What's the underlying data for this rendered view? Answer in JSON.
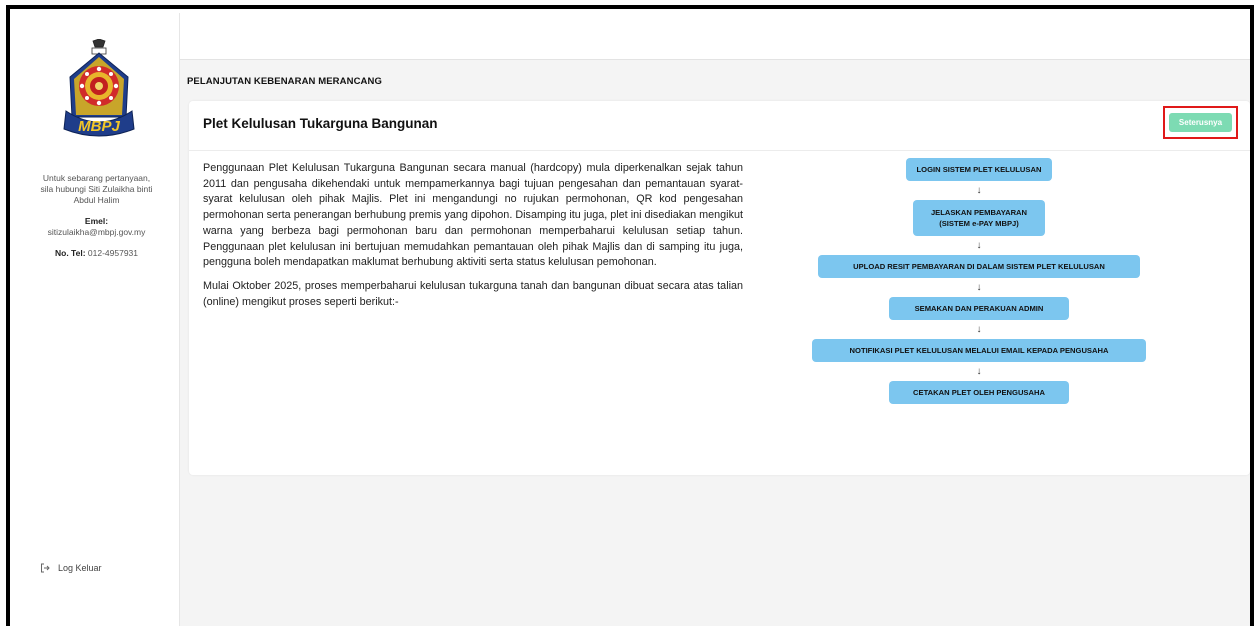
{
  "sidebar": {
    "contact_lines": [
      "Untuk sebarang pertanyaan,",
      "sila hubungi Siti Zulaikha binti",
      "Abdul Halim"
    ],
    "email_label": "Emel:",
    "email_value": "sitizulaikha@mbpj.gov.my",
    "phone_label": "No. Tel:",
    "phone_value": "012-4957931",
    "logout_label": "Log Keluar",
    "logo_text": "MBPJ"
  },
  "page": {
    "title": "PELANJUTAN KEBENARAN MERANCANG"
  },
  "card": {
    "title": "Plet Kelulusan Tukarguna Bangunan",
    "next_label": "Seterusnya",
    "paragraphs": [
      "Penggunaan Plet Kelulusan Tukarguna Bangunan secara manual (hardcopy) mula diperkenalkan sejak tahun 2011 dan pengusaha dikehendaki untuk mempamerkannya bagi tujuan pengesahan dan pemantauan syarat-syarat kelulusan oleh pihak Majlis. Plet ini mengandungi no rujukan permohonan, QR kod pengesahan permohonan serta penerangan berhubung premis yang dipohon. Disamping itu juga, plet ini disediakan mengikut warna yang berbeza bagi permohonan baru dan permohonan memperbaharui kelulusan setiap tahun. Penggunaan plet kelulusan ini bertujuan memudahkan pemantauan oleh pihak Majlis dan di samping itu juga, pengguna boleh mendapatkan maklumat berhubung aktiviti serta status kelulusan pemohonan.",
      "Mulai Oktober 2025, proses memperbaharui kelulusan tukarguna tanah dan bangunan dibuat secara atas talian (online) mengikut proses seperti berikut:-"
    ]
  },
  "flow": {
    "arrow": "↓",
    "steps": [
      [
        "LOGIN SISTEM PLET KELULUSAN"
      ],
      [
        "JELASKAN PEMBAYARAN",
        "(SISTEM e-PAY MBPJ)"
      ],
      [
        "UPLOAD RESIT PEMBAYARAN DI DALAM SISTEM PLET KELULUSAN"
      ],
      [
        "SEMAKAN DAN PERAKUAN ADMIN"
      ],
      [
        "NOTIFIKASI PLET KELULUSAN MELALUI EMAIL KEPADA PENGUSAHA"
      ],
      [
        "CETAKAN PLET OLEH PENGUSAHA"
      ]
    ]
  },
  "colors": {
    "step_bg": "#7cc6ef",
    "next_btn": "#7ddbb3",
    "highlight": "#e01919"
  }
}
